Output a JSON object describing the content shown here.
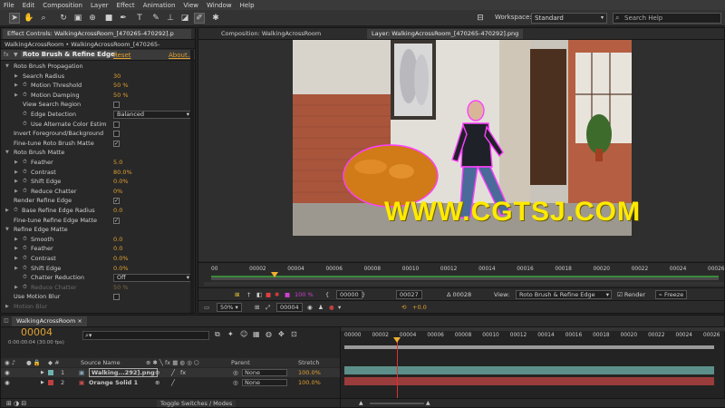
{
  "menu": [
    "File",
    "Edit",
    "Composition",
    "Layer",
    "Effect",
    "Animation",
    "View",
    "Window",
    "Help"
  ],
  "workspace": {
    "label": "Workspace:",
    "value": "Standard"
  },
  "search": {
    "placeholder": "Search Help"
  },
  "effect_controls": {
    "tab": "Effect Controls: WalkingAcrossRoom_[470265-470292].p",
    "subtitle": "WalkingAcrossRoom • WalkingAcrossRoom_[470265-470292].png",
    "effect_name": "Roto Brush & Refine Edge",
    "reset": "Reset",
    "about": "About...",
    "props": [
      {
        "label": "Roto Brush Propagation",
        "indent": 1,
        "arrow": "open"
      },
      {
        "label": "Search Radius",
        "indent": 2,
        "arrow": "closed",
        "value": "30"
      },
      {
        "label": "Motion Threshold",
        "indent": 2,
        "arrow": "closed",
        "stopwatch": true,
        "value": "50 %"
      },
      {
        "label": "Motion Damping",
        "indent": 2,
        "arrow": "closed",
        "stopwatch": true,
        "value": "50 %"
      },
      {
        "label": "View Search Region",
        "indent": 2,
        "check": false
      },
      {
        "label": "Edge Detection",
        "indent": 2,
        "stopwatch": true,
        "dropdown": "Balanced"
      },
      {
        "label": "Use Alternate Color Estim",
        "indent": 2,
        "stopwatch": true,
        "check": false
      },
      {
        "label": "Invert Foreground/Background",
        "indent": 1,
        "check": false
      },
      {
        "label": "Fine-tune Roto Brush Matte",
        "indent": 1,
        "check": true
      },
      {
        "label": "Roto Brush Matte",
        "indent": 1,
        "arrow": "open"
      },
      {
        "label": "Feather",
        "indent": 2,
        "arrow": "closed",
        "stopwatch": true,
        "value": "5.0"
      },
      {
        "label": "Contrast",
        "indent": 2,
        "arrow": "closed",
        "stopwatch": true,
        "value": "80.0%"
      },
      {
        "label": "Shift Edge",
        "indent": 2,
        "arrow": "closed",
        "stopwatch": true,
        "value": "0.0%"
      },
      {
        "label": "Reduce Chatter",
        "indent": 2,
        "arrow": "closed",
        "stopwatch": true,
        "value": "0%"
      },
      {
        "label": "Render Refine Edge",
        "indent": 1,
        "check": true
      },
      {
        "label": "Base Refine Edge Radius",
        "indent": 1,
        "arrow": "closed",
        "stopwatch": true,
        "value": "0.0"
      },
      {
        "label": "Fine-tune Refine Edge Matte",
        "indent": 1,
        "check": true
      },
      {
        "label": "Refine Edge Matte",
        "indent": 1,
        "arrow": "open"
      },
      {
        "label": "Smooth",
        "indent": 2,
        "arrow": "closed",
        "stopwatch": true,
        "value": "0.0"
      },
      {
        "label": "Feather",
        "indent": 2,
        "arrow": "closed",
        "stopwatch": true,
        "value": "0.0"
      },
      {
        "label": "Contrast",
        "indent": 2,
        "arrow": "closed",
        "stopwatch": true,
        "value": "0.0%"
      },
      {
        "label": "Shift Edge",
        "indent": 2,
        "arrow": "closed",
        "stopwatch": true,
        "value": "0.0%"
      },
      {
        "label": "Chatter Reduction",
        "indent": 2,
        "stopwatch": true,
        "dropdown": "Off"
      },
      {
        "label": "Reduce Chatter",
        "indent": 2,
        "arrow": "closed",
        "stopwatch": true,
        "value": "50 %",
        "dim": true
      },
      {
        "label": "Use Motion Blur",
        "indent": 1,
        "check": false
      },
      {
        "label": "Motion Blur",
        "indent": 1,
        "arrow": "closed",
        "dim": true
      }
    ]
  },
  "composition": {
    "tab_comp": "Composition: WalkingAcrossRoom",
    "tab_layer": "Layer: WalkingAcrossRoom_[470265-470292].png",
    "watermark": "WWW.CGTSJ.COM",
    "layer_ruler": [
      "00",
      "00002",
      "00004",
      "00006",
      "00008",
      "00010",
      "00012",
      "00014",
      "00016",
      "00018",
      "00020",
      "00022",
      "00024",
      "00026"
    ],
    "zoom": "50%",
    "current_frame": "00004",
    "opacity": "100 %",
    "in_frame": "00000",
    "out_frame": "00027",
    "duration": "Δ 00028",
    "view_label": "View:",
    "view_value": "Roto Brush & Refine Edge",
    "render_label": "Render",
    "freeze_label": "Freeze",
    "exposure": "+0.0"
  },
  "timeline": {
    "tab": "WalkingAcrossRoom",
    "timecode": "00004",
    "timecode_sub": "0:00:00:04 (30.00 fps)",
    "search_placeholder": "",
    "col_source": "Source Name",
    "col_parent": "Parent",
    "col_stretch": "Stretch",
    "layers": [
      {
        "num": "1",
        "name": "Walking...292].png",
        "parent": "None",
        "stretch": "100.0%",
        "color": "#6fb3b0"
      },
      {
        "num": "2",
        "name": "Orange Solid 1",
        "parent": "None",
        "stretch": "100.0%",
        "color": "#c04040"
      }
    ],
    "ruler": [
      "00000",
      "00002",
      "00004",
      "00006",
      "00008",
      "00010",
      "00012",
      "00014",
      "00016",
      "00018",
      "00020",
      "00022",
      "00024",
      "00026"
    ],
    "toggle_label": "Toggle Switches / Modes",
    "current_fraction": 0.143
  }
}
